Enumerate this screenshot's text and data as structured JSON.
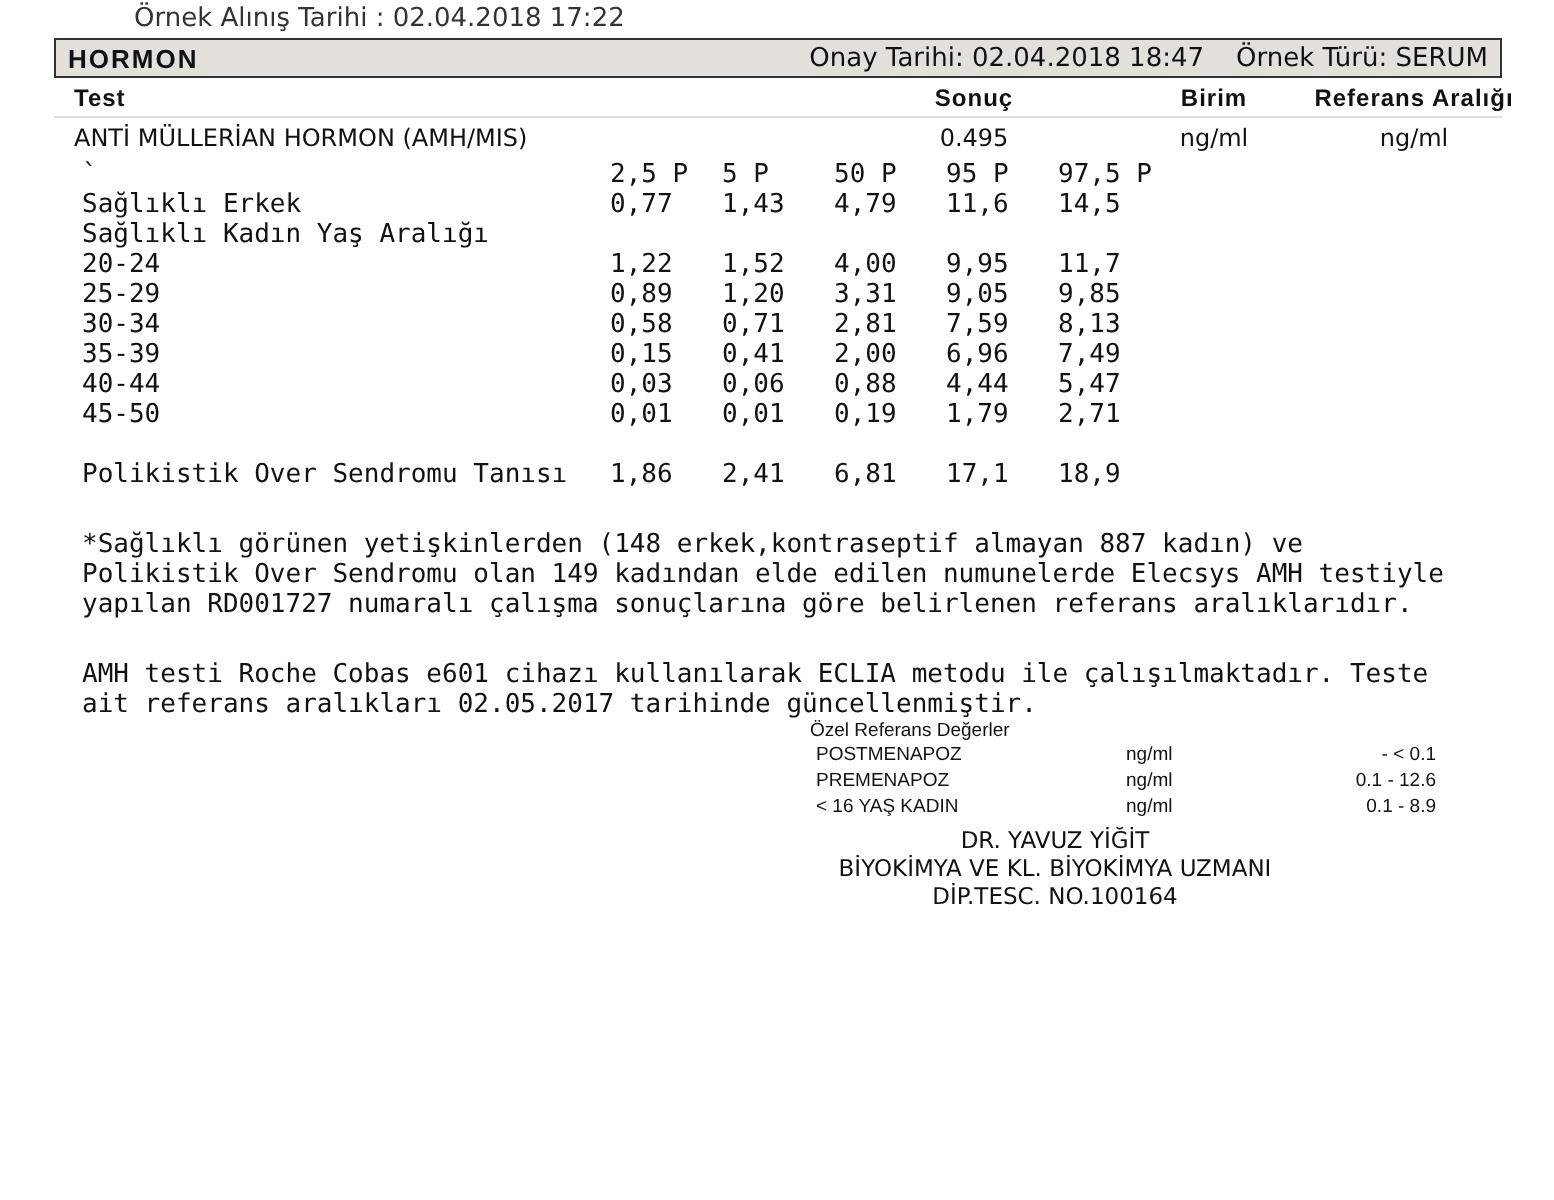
{
  "sample_line": "Örnek Alınış Tarihi  : 02.04.2018 17:22",
  "section": {
    "title": "HORMON",
    "approval": "Onay Tarihi: 02.04.2018 18:47",
    "sample_type": "Örnek Türü: SERUM"
  },
  "columns": [
    "Test",
    "Sonuç",
    "Birim",
    "Referans Aralığı"
  ],
  "result": {
    "test": "ANTİ MÜLLERİAN HORMON (AMH/MIS)",
    "value": "0.495",
    "unit": "ng/ml",
    "reference": "ng/ml"
  },
  "percentile_table": {
    "rows": [
      {
        "label": "`",
        "values": [
          "2,5 P",
          "5 P",
          "50 P",
          "95 P",
          "97,5 P"
        ]
      },
      {
        "label": "Sağlıklı Erkek",
        "values": [
          "0,77",
          "1,43",
          "4,79",
          "11,6",
          "14,5"
        ]
      },
      {
        "label": "Sağlıklı Kadın Yaş Aralığı",
        "values": []
      },
      {
        "label": "20-24",
        "values": [
          "1,22",
          "1,52",
          "4,00",
          "9,95",
          "11,7"
        ]
      },
      {
        "label": "25-29",
        "values": [
          "0,89",
          "1,20",
          "3,31",
          "9,05",
          "9,85"
        ]
      },
      {
        "label": "30-34",
        "values": [
          "0,58",
          "0,71",
          "2,81",
          "7,59",
          "8,13"
        ]
      },
      {
        "label": "35-39",
        "values": [
          "0,15",
          "0,41",
          "2,00",
          "6,96",
          "7,49"
        ]
      },
      {
        "label": "40-44",
        "values": [
          "0,03",
          "0,06",
          "0,88",
          "4,44",
          "5,47"
        ]
      },
      {
        "label": "45-50",
        "values": [
          "0,01",
          "0,01",
          "0,19",
          "1,79",
          "2,71"
        ]
      }
    ],
    "pcos_row": {
      "label": "Polikistik Over Sendromu Tanısı",
      "values": [
        "1,86",
        "2,41",
        "6,81",
        "17,1",
        "18,9"
      ]
    }
  },
  "notes": [
    "*Sağlıklı görünen yetişkinlerden (148 erkek,kontraseptif almayan 887 kadın) ve\nPolikistik Over Sendromu olan 149 kadından elde edilen numunelerde Elecsys AMH testiyle\nyapılan RD001727 numaralı çalışma sonuçlarına göre belirlenen referans aralıklarıdır.",
    "AMH testi Roche Cobas e601 cihazı kullanılarak ECLIA metodu ile çalışılmaktadır. Teste\nait referans aralıkları 02.05.2017 tarihinde güncellenmiştir."
  ],
  "special_reference": {
    "title": "Özel Referans Değerler",
    "rows": [
      {
        "name": "POSTMENAPOZ",
        "unit": "ng/ml",
        "range": "- < 0.1"
      },
      {
        "name": "PREMENAPOZ",
        "unit": "ng/ml",
        "range": "0.1 - 12.6"
      },
      {
        "name": "< 16 YAŞ KADIN",
        "unit": "ng/ml",
        "range": "0.1 - 8.9"
      }
    ]
  },
  "signature": [
    "DR. YAVUZ YİĞİT",
    "BİYOKİMYA VE KL. BİYOKİMYA UZMANI",
    "DİP.TESC. NO.100164"
  ]
}
